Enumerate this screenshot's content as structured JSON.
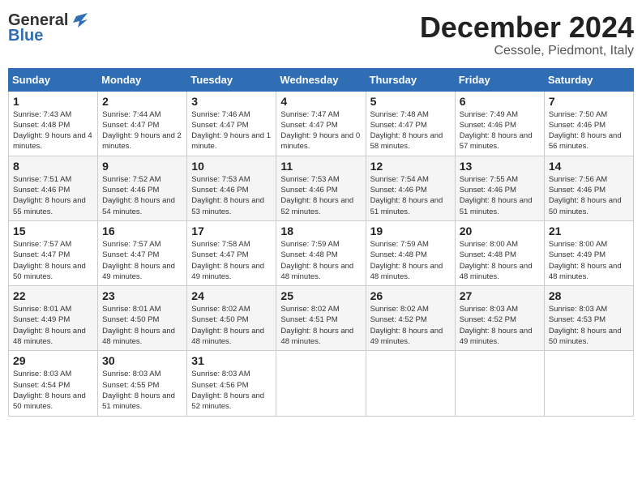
{
  "header": {
    "logo_general": "General",
    "logo_blue": "Blue",
    "month_title": "December 2024",
    "subtitle": "Cessole, Piedmont, Italy"
  },
  "days_of_week": [
    "Sunday",
    "Monday",
    "Tuesday",
    "Wednesday",
    "Thursday",
    "Friday",
    "Saturday"
  ],
  "weeks": [
    [
      {
        "day": "1",
        "sunrise": "Sunrise: 7:43 AM",
        "sunset": "Sunset: 4:48 PM",
        "daylight": "Daylight: 9 hours and 4 minutes."
      },
      {
        "day": "2",
        "sunrise": "Sunrise: 7:44 AM",
        "sunset": "Sunset: 4:47 PM",
        "daylight": "Daylight: 9 hours and 2 minutes."
      },
      {
        "day": "3",
        "sunrise": "Sunrise: 7:46 AM",
        "sunset": "Sunset: 4:47 PM",
        "daylight": "Daylight: 9 hours and 1 minute."
      },
      {
        "day": "4",
        "sunrise": "Sunrise: 7:47 AM",
        "sunset": "Sunset: 4:47 PM",
        "daylight": "Daylight: 9 hours and 0 minutes."
      },
      {
        "day": "5",
        "sunrise": "Sunrise: 7:48 AM",
        "sunset": "Sunset: 4:47 PM",
        "daylight": "Daylight: 8 hours and 58 minutes."
      },
      {
        "day": "6",
        "sunrise": "Sunrise: 7:49 AM",
        "sunset": "Sunset: 4:46 PM",
        "daylight": "Daylight: 8 hours and 57 minutes."
      },
      {
        "day": "7",
        "sunrise": "Sunrise: 7:50 AM",
        "sunset": "Sunset: 4:46 PM",
        "daylight": "Daylight: 8 hours and 56 minutes."
      }
    ],
    [
      {
        "day": "8",
        "sunrise": "Sunrise: 7:51 AM",
        "sunset": "Sunset: 4:46 PM",
        "daylight": "Daylight: 8 hours and 55 minutes."
      },
      {
        "day": "9",
        "sunrise": "Sunrise: 7:52 AM",
        "sunset": "Sunset: 4:46 PM",
        "daylight": "Daylight: 8 hours and 54 minutes."
      },
      {
        "day": "10",
        "sunrise": "Sunrise: 7:53 AM",
        "sunset": "Sunset: 4:46 PM",
        "daylight": "Daylight: 8 hours and 53 minutes."
      },
      {
        "day": "11",
        "sunrise": "Sunrise: 7:53 AM",
        "sunset": "Sunset: 4:46 PM",
        "daylight": "Daylight: 8 hours and 52 minutes."
      },
      {
        "day": "12",
        "sunrise": "Sunrise: 7:54 AM",
        "sunset": "Sunset: 4:46 PM",
        "daylight": "Daylight: 8 hours and 51 minutes."
      },
      {
        "day": "13",
        "sunrise": "Sunrise: 7:55 AM",
        "sunset": "Sunset: 4:46 PM",
        "daylight": "Daylight: 8 hours and 51 minutes."
      },
      {
        "day": "14",
        "sunrise": "Sunrise: 7:56 AM",
        "sunset": "Sunset: 4:46 PM",
        "daylight": "Daylight: 8 hours and 50 minutes."
      }
    ],
    [
      {
        "day": "15",
        "sunrise": "Sunrise: 7:57 AM",
        "sunset": "Sunset: 4:47 PM",
        "daylight": "Daylight: 8 hours and 50 minutes."
      },
      {
        "day": "16",
        "sunrise": "Sunrise: 7:57 AM",
        "sunset": "Sunset: 4:47 PM",
        "daylight": "Daylight: 8 hours and 49 minutes."
      },
      {
        "day": "17",
        "sunrise": "Sunrise: 7:58 AM",
        "sunset": "Sunset: 4:47 PM",
        "daylight": "Daylight: 8 hours and 49 minutes."
      },
      {
        "day": "18",
        "sunrise": "Sunrise: 7:59 AM",
        "sunset": "Sunset: 4:48 PM",
        "daylight": "Daylight: 8 hours and 48 minutes."
      },
      {
        "day": "19",
        "sunrise": "Sunrise: 7:59 AM",
        "sunset": "Sunset: 4:48 PM",
        "daylight": "Daylight: 8 hours and 48 minutes."
      },
      {
        "day": "20",
        "sunrise": "Sunrise: 8:00 AM",
        "sunset": "Sunset: 4:48 PM",
        "daylight": "Daylight: 8 hours and 48 minutes."
      },
      {
        "day": "21",
        "sunrise": "Sunrise: 8:00 AM",
        "sunset": "Sunset: 4:49 PM",
        "daylight": "Daylight: 8 hours and 48 minutes."
      }
    ],
    [
      {
        "day": "22",
        "sunrise": "Sunrise: 8:01 AM",
        "sunset": "Sunset: 4:49 PM",
        "daylight": "Daylight: 8 hours and 48 minutes."
      },
      {
        "day": "23",
        "sunrise": "Sunrise: 8:01 AM",
        "sunset": "Sunset: 4:50 PM",
        "daylight": "Daylight: 8 hours and 48 minutes."
      },
      {
        "day": "24",
        "sunrise": "Sunrise: 8:02 AM",
        "sunset": "Sunset: 4:50 PM",
        "daylight": "Daylight: 8 hours and 48 minutes."
      },
      {
        "day": "25",
        "sunrise": "Sunrise: 8:02 AM",
        "sunset": "Sunset: 4:51 PM",
        "daylight": "Daylight: 8 hours and 48 minutes."
      },
      {
        "day": "26",
        "sunrise": "Sunrise: 8:02 AM",
        "sunset": "Sunset: 4:52 PM",
        "daylight": "Daylight: 8 hours and 49 minutes."
      },
      {
        "day": "27",
        "sunrise": "Sunrise: 8:03 AM",
        "sunset": "Sunset: 4:52 PM",
        "daylight": "Daylight: 8 hours and 49 minutes."
      },
      {
        "day": "28",
        "sunrise": "Sunrise: 8:03 AM",
        "sunset": "Sunset: 4:53 PM",
        "daylight": "Daylight: 8 hours and 50 minutes."
      }
    ],
    [
      {
        "day": "29",
        "sunrise": "Sunrise: 8:03 AM",
        "sunset": "Sunset: 4:54 PM",
        "daylight": "Daylight: 8 hours and 50 minutes."
      },
      {
        "day": "30",
        "sunrise": "Sunrise: 8:03 AM",
        "sunset": "Sunset: 4:55 PM",
        "daylight": "Daylight: 8 hours and 51 minutes."
      },
      {
        "day": "31",
        "sunrise": "Sunrise: 8:03 AM",
        "sunset": "Sunset: 4:56 PM",
        "daylight": "Daylight: 8 hours and 52 minutes."
      },
      null,
      null,
      null,
      null
    ]
  ]
}
